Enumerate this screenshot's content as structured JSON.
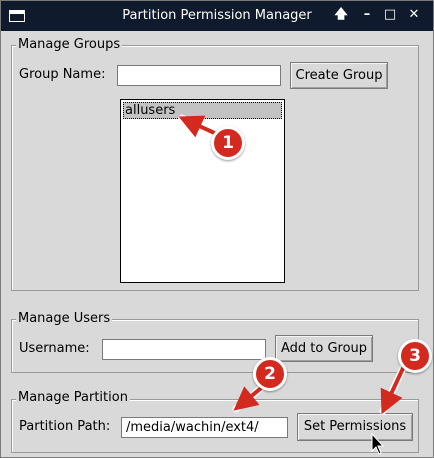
{
  "window": {
    "title": "Partition Permission Manager",
    "controls": {
      "up": "🡅",
      "minimize": "–",
      "maximize": "□",
      "close": "✕"
    }
  },
  "manage_groups": {
    "section_label": "Manage Groups",
    "group_name_label": "Group Name:",
    "group_name_value": "",
    "create_button": "Create Group",
    "groups": [
      "allusers"
    ]
  },
  "manage_users": {
    "section_label": "Manage Users",
    "username_label": "Username:",
    "username_value": "",
    "add_button": "Add to Group"
  },
  "manage_partition": {
    "section_label": "Manage Partition",
    "path_label": "Partition Path:",
    "path_value": "/media/wachin/ext4/",
    "set_button": "Set Permissions"
  },
  "annotations": {
    "marker_1": "1",
    "marker_2": "2",
    "marker_3": "3",
    "color": "#d32a20"
  }
}
